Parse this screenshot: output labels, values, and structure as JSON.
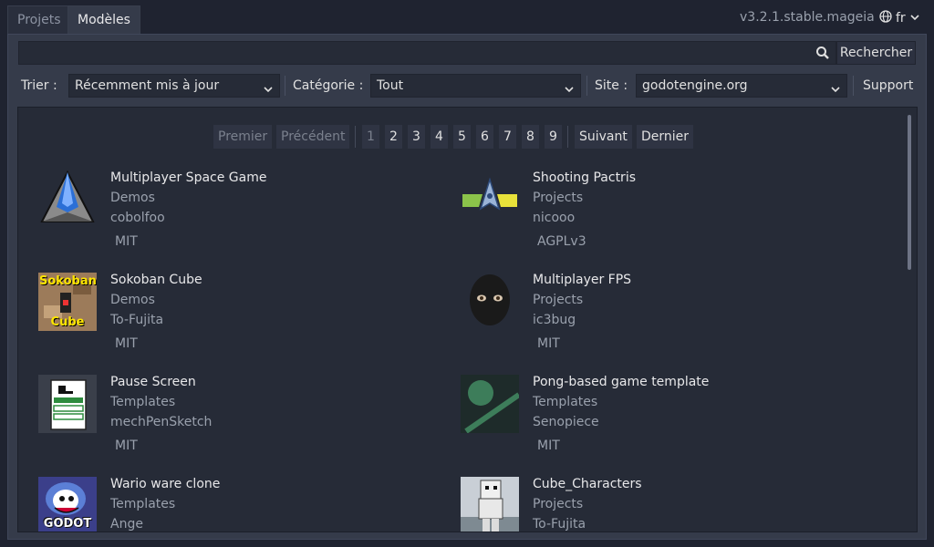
{
  "tabs": [
    {
      "label": "Projets"
    },
    {
      "label": "Modèles"
    }
  ],
  "version": "v3.2.1.stable.mageia",
  "language": "fr",
  "search": {
    "placeholder": "",
    "button_label": "Rechercher"
  },
  "filters": {
    "sort_label": "Trier :",
    "sort_value": "Récemment mis à jour",
    "category_label": "Catégorie :",
    "category_value": "Tout",
    "site_label": "Site :",
    "site_value": "godotengine.org",
    "support_label": "Support"
  },
  "pager": {
    "first": "Premier",
    "previous": "Précédent",
    "pages": [
      "1",
      "2",
      "3",
      "4",
      "5",
      "6",
      "7",
      "8",
      "9"
    ],
    "current": "1",
    "next": "Suivant",
    "last": "Dernier"
  },
  "items": [
    {
      "title": "Multiplayer Space Game",
      "category": "Demos",
      "author": "cobolfoo",
      "license": "MIT"
    },
    {
      "title": "Shooting Pactris",
      "category": "Projects",
      "author": "nicooo",
      "license": "AGPLv3"
    },
    {
      "title": "Sokoban Cube",
      "category": "Demos",
      "author": "To-Fujita",
      "license": "MIT",
      "thumb_text_top": "Sokoban",
      "thumb_text_bottom": "Cube"
    },
    {
      "title": "Multiplayer FPS",
      "category": "Projects",
      "author": "ic3bug",
      "license": "MIT"
    },
    {
      "title": "Pause Screen",
      "category": "Templates",
      "author": "mechPenSketch",
      "license": "MIT"
    },
    {
      "title": "Pong-based game template",
      "category": "Templates",
      "author": "Senopiece",
      "license": "MIT"
    },
    {
      "title": "Wario ware clone",
      "category": "Templates",
      "author": "Ange",
      "license": "",
      "thumb_text": "GODOT"
    },
    {
      "title": "Cube_Characters",
      "category": "Projects",
      "author": "To-Fujita",
      "license": ""
    }
  ]
}
